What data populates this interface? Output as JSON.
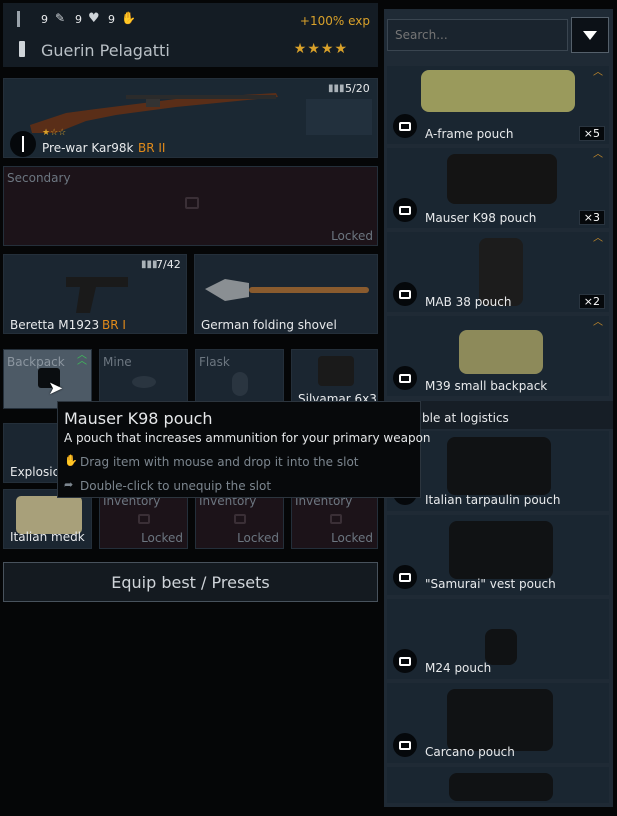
{
  "soldier": {
    "stat1": "9",
    "stat2": "9",
    "stat3": "9",
    "exp_bonus": "+100% exp",
    "name": "Guerin Pelagatti",
    "stars": "★★★★"
  },
  "primary": {
    "stars": "★☆☆",
    "name": "Pre-war Kar98k",
    "br": "BR II",
    "ammo": "5/20"
  },
  "secondary": {
    "label": "Secondary",
    "status": "Locked"
  },
  "sidearm": {
    "name": "Beretta M1923",
    "br": "BR I",
    "ammo": "7/42"
  },
  "melee": {
    "name": "German folding shovel"
  },
  "small_slots": {
    "backpack": "Backpack",
    "mine": "Mine",
    "flask": "Flask",
    "binoculars": "Silvamar 6x3",
    "explosive": "Explosic",
    "medkit": "Italian medk",
    "inv1": "Inventory",
    "inv2": "Inventory",
    "inv3": "Inventory",
    "locked1": "Locked",
    "locked2": "Locked",
    "locked3": "Locked"
  },
  "equip_button": "Equip best / Presets",
  "tooltip": {
    "title": "Mauser K98 pouch",
    "description": "A pouch that increases ammunition for your primary weapon",
    "hint_drag": "Drag item with mouse and drop it into the slot",
    "hint_dblclick": "Double-click to unequip the slot"
  },
  "search": {
    "placeholder": "Search..."
  },
  "inventory_items": [
    {
      "name": "A-frame pouch",
      "count": "×5"
    },
    {
      "name": "Mauser K98 pouch",
      "count": "×3"
    },
    {
      "name": "MAB 38 pouch",
      "count": "×2"
    },
    {
      "name": "M39 small backpack",
      "count": ""
    }
  ],
  "logistics_header": "ble at logistics",
  "logistics_items": [
    {
      "name": "Italian tarpaulin pouch"
    },
    {
      "name": "\"Samurai\" vest pouch"
    },
    {
      "name": "M24 pouch"
    },
    {
      "name": "Carcano pouch"
    }
  ],
  "colors": {
    "accent": "#d9a12a",
    "br": "#e08a1a",
    "upgrade": "#3ec05a"
  }
}
